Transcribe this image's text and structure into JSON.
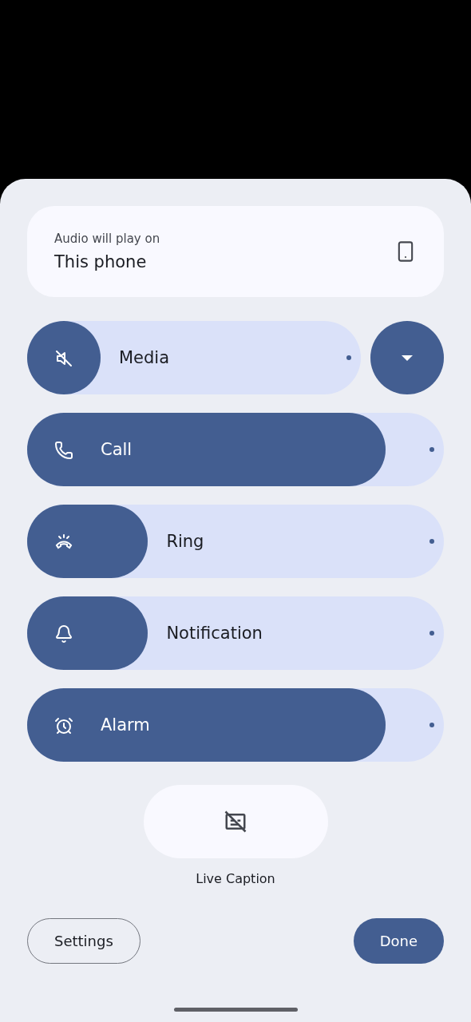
{
  "output": {
    "label": "Audio will play on",
    "device": "This phone"
  },
  "sliders": [
    {
      "label": "Media",
      "kind": "media",
      "muted": true,
      "level": 0.22,
      "expand": true
    },
    {
      "label": "Call",
      "kind": "call",
      "level": 0.86
    },
    {
      "label": "Ring",
      "kind": "ring",
      "level": 0.29
    },
    {
      "label": "Notification",
      "kind": "notification",
      "level": 0.29
    },
    {
      "label": "Alarm",
      "kind": "alarm",
      "level": 0.86
    }
  ],
  "live_caption": {
    "label": "Live Caption",
    "on": false
  },
  "buttons": [
    {
      "label": "Settings",
      "kind": "outlined"
    },
    {
      "label": "Done",
      "kind": "filled"
    }
  ]
}
